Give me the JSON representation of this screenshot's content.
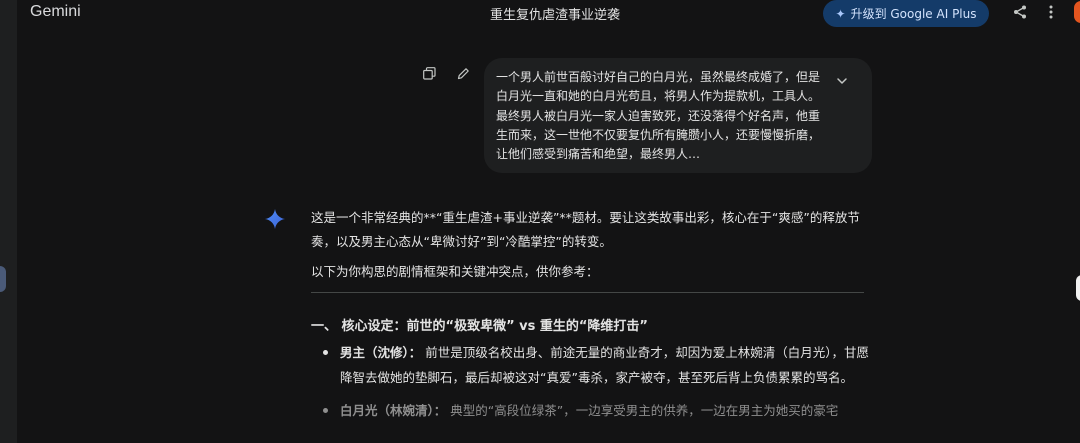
{
  "app": {
    "brand": "Gemini"
  },
  "header": {
    "conversation_title": "重生复仇虐渣事业逆袭",
    "upgrade_label": "升级到 Google AI Plus",
    "icons": {
      "share": "share-icon",
      "more": "more-vert-icon",
      "upgrade": "sparkle-icon"
    },
    "colors": {
      "upgrade_bg": "#143b69",
      "avatar": "#e3551f"
    }
  },
  "user_message": {
    "text": "一个男人前世百般讨好自己的白月光，虽然最终成婚了，但是白月光一直和她的白月光苟且，将男人作为提款机，工具人。最终男人被白月光一家人迫害致死，还没落得个好名声，他重生而来，这一世他不仅要复仇所有腌臜小人，还要慢慢折磨，让他们感受到痛苦和绝望，最终男人…",
    "actions": {
      "copy": "copy-icon",
      "edit": "edit-icon",
      "expand": "chevron-down-icon"
    }
  },
  "response": {
    "intro": "这是一个非常经典的**“重生虐渣+事业逆袭”**题材。要让这类故事出彩，核心在于“爽感”的释放节奏，以及男主心态从“卑微讨好”到“冷酷掌控”的转变。",
    "lead": "以下为你构思的剧情框架和关键冲突点，供你参考：",
    "section_heading": "一、 核心设定：前世的“极致卑微” vs 重生的“降维打击”",
    "bullets": [
      {
        "term": "男主（沈修）：",
        "text": " 前世是顶级名校出身、前途无量的商业奇才，却因为爱上林婉清（白月光），甘愿降智去做她的垫脚石，最后却被这对“真爱”毒杀，家产被夺，甚至死后背上负债累累的骂名。"
      },
      {
        "term": "白月光（林婉清）：",
        "text": " 典型的“高段位绿茶”，一边享受男主的供养，一边在男主为她买的豪宅"
      }
    ]
  }
}
